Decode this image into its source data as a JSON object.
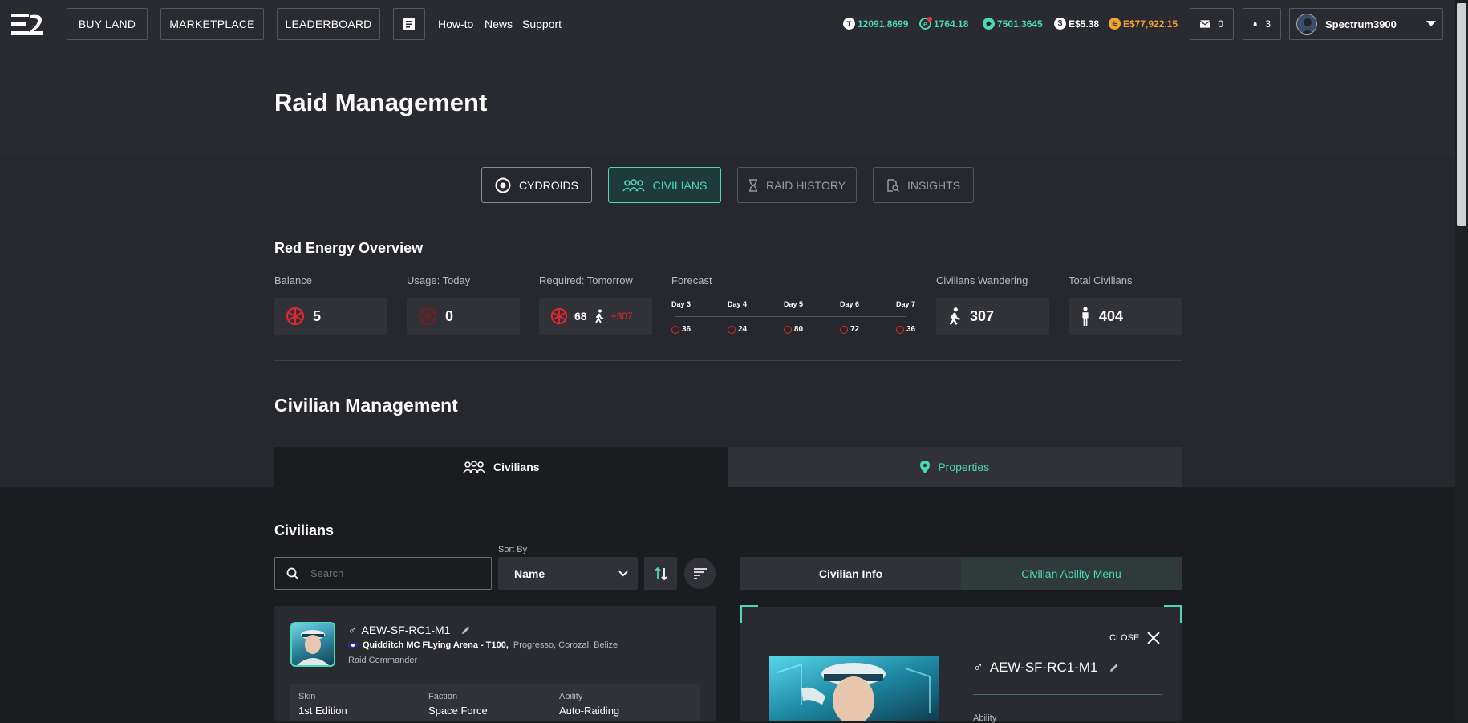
{
  "nav": {
    "buy_land": "BUY LAND",
    "marketplace": "MARKETPLACE",
    "leaderboard": "LEADERBOARD",
    "howto": "How-to",
    "news": "News",
    "support": "Support"
  },
  "balances": [
    {
      "icon": "tile-currency-icon",
      "value": "12091.8699",
      "color": "#4bd8b5"
    },
    {
      "icon": "element-currency-icon",
      "value": "1764.18",
      "color": "#4bd8b5"
    },
    {
      "icon": "ether-shard-icon",
      "value": "7501.3645",
      "color": "#4bd8b5"
    },
    {
      "icon": "dollar-icon",
      "value": "E$5.38",
      "color": "#ffffff"
    },
    {
      "icon": "essence-coin-icon",
      "value": "E$77,922.15",
      "color": "#f0a530"
    }
  ],
  "mail_count": "0",
  "notif_count": "3",
  "username": "Spectrum3900",
  "page_title": "Raid Management",
  "tabs": {
    "cydroids": "CYDROIDS",
    "civilians": "CIVILIANS",
    "raid_history": "RAID HISTORY",
    "insights": "INSIGHTS"
  },
  "overview": {
    "title": "Red Energy Overview",
    "balance_label": "Balance",
    "balance": "5",
    "usage_label": "Usage: Today",
    "usage": "0",
    "required_label": "Required: Tomorrow",
    "required": "68",
    "required_extra": "+307",
    "forecast_label": "Forecast",
    "forecast": [
      {
        "day": "Day 3",
        "value": "36"
      },
      {
        "day": "Day 4",
        "value": "24"
      },
      {
        "day": "Day 5",
        "value": "80"
      },
      {
        "day": "Day 6",
        "value": "72"
      },
      {
        "day": "Day 7",
        "value": "36"
      }
    ],
    "wandering_label": "Civilians Wandering",
    "wandering": "307",
    "total_label": "Total Civilians",
    "total": "404"
  },
  "civ_mgmt": {
    "title": "Civilian Management",
    "tab_civilians": "Civilians",
    "tab_properties": "Properties"
  },
  "civilians": {
    "title": "Civilians",
    "search_placeholder": "Search",
    "sort_label": "Sort By",
    "sort_value": "Name",
    "card": {
      "name": "AEW-SF-RC1-M1",
      "property": "Quidditch MC FLying Arena - T100,",
      "location": "Progresso, Corozal, Belize",
      "role": "Raid Commander",
      "skin_label": "Skin",
      "skin": "1st Edition",
      "faction_label": "Faction",
      "faction": "Space Force",
      "ability_label": "Ability",
      "ability": "Auto-Raiding"
    }
  },
  "info": {
    "tab_info": "Civilian Info",
    "tab_ability": "Civilian Ability Menu",
    "close": "CLOSE",
    "name": "AEW-SF-RC1-M1",
    "ability_label": "Ability"
  }
}
